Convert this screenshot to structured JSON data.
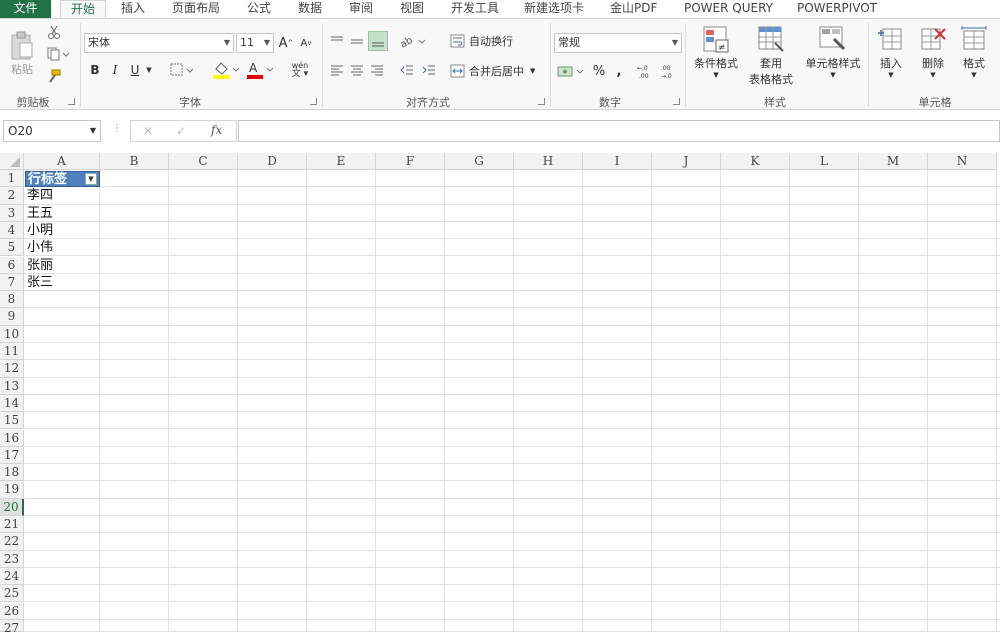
{
  "tabs": {
    "file": "文件",
    "home": "开始",
    "insert": "插入",
    "layout": "页面布局",
    "formulas": "公式",
    "data": "数据",
    "review": "审阅",
    "view": "视图",
    "developer": "开发工具",
    "newtab": "新建选项卡",
    "pdf": "金山PDF",
    "powerquery": "POWER QUERY",
    "powerpivot": "POWERPIVOT"
  },
  "ribbon": {
    "clipboard": {
      "paste": "粘贴",
      "label": "剪贴板"
    },
    "font": {
      "name": "宋体",
      "size": "11",
      "label": "字体",
      "bold": "B",
      "italic": "I",
      "underline": "U",
      "grow": "A",
      "shrink": "A",
      "fontcolor": "A",
      "phonetic": "wén"
    },
    "align": {
      "wrap": "自动换行",
      "merge": "合并后居中",
      "label": "对齐方式"
    },
    "number": {
      "format": "常规",
      "percent": "%",
      "comma": ",",
      "label": "数字"
    },
    "styles": {
      "conditional": "条件格式",
      "table1": "套用",
      "table2": "表格格式",
      "cellstyle": "单元格样式",
      "label": "样式"
    },
    "cells": {
      "insert": "插入",
      "delete": "删除",
      "format": "格式",
      "label": "单元格"
    }
  },
  "formula_bar": {
    "name_box": "O20",
    "fx": "fx",
    "cancel": "✕",
    "enter": "✓",
    "value": ""
  },
  "columns": [
    "A",
    "B",
    "C",
    "D",
    "E",
    "F",
    "G",
    "H",
    "I",
    "J",
    "K",
    "L",
    "M",
    "N"
  ],
  "rows": [
    "1",
    "2",
    "3",
    "4",
    "5",
    "6",
    "7",
    "8",
    "9",
    "10",
    "11",
    "12",
    "13",
    "14",
    "15",
    "16",
    "17",
    "18",
    "19",
    "20",
    "21",
    "22",
    "23",
    "24",
    "25",
    "26",
    "27"
  ],
  "pivot": {
    "header": "行标签",
    "items": [
      "李四",
      "王五",
      "小明",
      "小伟",
      "张丽",
      "张三"
    ]
  },
  "selected_row": "20",
  "colors": {
    "accent": "#217346",
    "header_fill": "#4f81bd"
  }
}
